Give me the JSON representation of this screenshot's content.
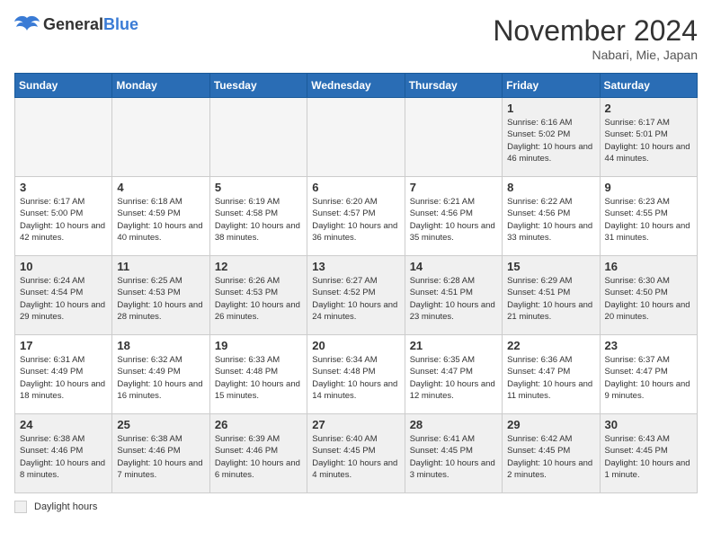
{
  "logo": {
    "general": "General",
    "blue": "Blue"
  },
  "header": {
    "month": "November 2024",
    "location": "Nabari, Mie, Japan"
  },
  "weekdays": [
    "Sunday",
    "Monday",
    "Tuesday",
    "Wednesday",
    "Thursday",
    "Friday",
    "Saturday"
  ],
  "legend": {
    "shaded_label": "Daylight hours"
  },
  "weeks": [
    [
      {
        "day": "",
        "empty": true
      },
      {
        "day": "",
        "empty": true
      },
      {
        "day": "",
        "empty": true
      },
      {
        "day": "",
        "empty": true
      },
      {
        "day": "",
        "empty": true
      },
      {
        "day": "1",
        "sunrise": "Sunrise: 6:16 AM",
        "sunset": "Sunset: 5:02 PM",
        "daylight": "Daylight: 10 hours and 46 minutes."
      },
      {
        "day": "2",
        "sunrise": "Sunrise: 6:17 AM",
        "sunset": "Sunset: 5:01 PM",
        "daylight": "Daylight: 10 hours and 44 minutes."
      }
    ],
    [
      {
        "day": "3",
        "sunrise": "Sunrise: 6:17 AM",
        "sunset": "Sunset: 5:00 PM",
        "daylight": "Daylight: 10 hours and 42 minutes."
      },
      {
        "day": "4",
        "sunrise": "Sunrise: 6:18 AM",
        "sunset": "Sunset: 4:59 PM",
        "daylight": "Daylight: 10 hours and 40 minutes."
      },
      {
        "day": "5",
        "sunrise": "Sunrise: 6:19 AM",
        "sunset": "Sunset: 4:58 PM",
        "daylight": "Daylight: 10 hours and 38 minutes."
      },
      {
        "day": "6",
        "sunrise": "Sunrise: 6:20 AM",
        "sunset": "Sunset: 4:57 PM",
        "daylight": "Daylight: 10 hours and 36 minutes."
      },
      {
        "day": "7",
        "sunrise": "Sunrise: 6:21 AM",
        "sunset": "Sunset: 4:56 PM",
        "daylight": "Daylight: 10 hours and 35 minutes."
      },
      {
        "day": "8",
        "sunrise": "Sunrise: 6:22 AM",
        "sunset": "Sunset: 4:56 PM",
        "daylight": "Daylight: 10 hours and 33 minutes."
      },
      {
        "day": "9",
        "sunrise": "Sunrise: 6:23 AM",
        "sunset": "Sunset: 4:55 PM",
        "daylight": "Daylight: 10 hours and 31 minutes."
      }
    ],
    [
      {
        "day": "10",
        "sunrise": "Sunrise: 6:24 AM",
        "sunset": "Sunset: 4:54 PM",
        "daylight": "Daylight: 10 hours and 29 minutes."
      },
      {
        "day": "11",
        "sunrise": "Sunrise: 6:25 AM",
        "sunset": "Sunset: 4:53 PM",
        "daylight": "Daylight: 10 hours and 28 minutes."
      },
      {
        "day": "12",
        "sunrise": "Sunrise: 6:26 AM",
        "sunset": "Sunset: 4:53 PM",
        "daylight": "Daylight: 10 hours and 26 minutes."
      },
      {
        "day": "13",
        "sunrise": "Sunrise: 6:27 AM",
        "sunset": "Sunset: 4:52 PM",
        "daylight": "Daylight: 10 hours and 24 minutes."
      },
      {
        "day": "14",
        "sunrise": "Sunrise: 6:28 AM",
        "sunset": "Sunset: 4:51 PM",
        "daylight": "Daylight: 10 hours and 23 minutes."
      },
      {
        "day": "15",
        "sunrise": "Sunrise: 6:29 AM",
        "sunset": "Sunset: 4:51 PM",
        "daylight": "Daylight: 10 hours and 21 minutes."
      },
      {
        "day": "16",
        "sunrise": "Sunrise: 6:30 AM",
        "sunset": "Sunset: 4:50 PM",
        "daylight": "Daylight: 10 hours and 20 minutes."
      }
    ],
    [
      {
        "day": "17",
        "sunrise": "Sunrise: 6:31 AM",
        "sunset": "Sunset: 4:49 PM",
        "daylight": "Daylight: 10 hours and 18 minutes."
      },
      {
        "day": "18",
        "sunrise": "Sunrise: 6:32 AM",
        "sunset": "Sunset: 4:49 PM",
        "daylight": "Daylight: 10 hours and 16 minutes."
      },
      {
        "day": "19",
        "sunrise": "Sunrise: 6:33 AM",
        "sunset": "Sunset: 4:48 PM",
        "daylight": "Daylight: 10 hours and 15 minutes."
      },
      {
        "day": "20",
        "sunrise": "Sunrise: 6:34 AM",
        "sunset": "Sunset: 4:48 PM",
        "daylight": "Daylight: 10 hours and 14 minutes."
      },
      {
        "day": "21",
        "sunrise": "Sunrise: 6:35 AM",
        "sunset": "Sunset: 4:47 PM",
        "daylight": "Daylight: 10 hours and 12 minutes."
      },
      {
        "day": "22",
        "sunrise": "Sunrise: 6:36 AM",
        "sunset": "Sunset: 4:47 PM",
        "daylight": "Daylight: 10 hours and 11 minutes."
      },
      {
        "day": "23",
        "sunrise": "Sunrise: 6:37 AM",
        "sunset": "Sunset: 4:47 PM",
        "daylight": "Daylight: 10 hours and 9 minutes."
      }
    ],
    [
      {
        "day": "24",
        "sunrise": "Sunrise: 6:38 AM",
        "sunset": "Sunset: 4:46 PM",
        "daylight": "Daylight: 10 hours and 8 minutes."
      },
      {
        "day": "25",
        "sunrise": "Sunrise: 6:38 AM",
        "sunset": "Sunset: 4:46 PM",
        "daylight": "Daylight: 10 hours and 7 minutes."
      },
      {
        "day": "26",
        "sunrise": "Sunrise: 6:39 AM",
        "sunset": "Sunset: 4:46 PM",
        "daylight": "Daylight: 10 hours and 6 minutes."
      },
      {
        "day": "27",
        "sunrise": "Sunrise: 6:40 AM",
        "sunset": "Sunset: 4:45 PM",
        "daylight": "Daylight: 10 hours and 4 minutes."
      },
      {
        "day": "28",
        "sunrise": "Sunrise: 6:41 AM",
        "sunset": "Sunset: 4:45 PM",
        "daylight": "Daylight: 10 hours and 3 minutes."
      },
      {
        "day": "29",
        "sunrise": "Sunrise: 6:42 AM",
        "sunset": "Sunset: 4:45 PM",
        "daylight": "Daylight: 10 hours and 2 minutes."
      },
      {
        "day": "30",
        "sunrise": "Sunrise: 6:43 AM",
        "sunset": "Sunset: 4:45 PM",
        "daylight": "Daylight: 10 hours and 1 minute."
      }
    ]
  ]
}
